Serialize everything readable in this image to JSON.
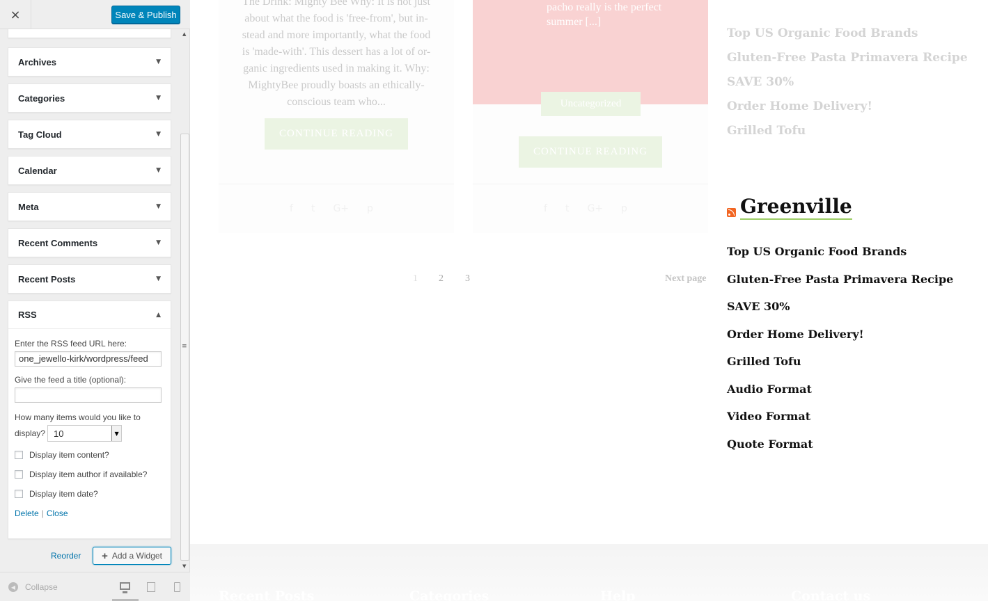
{
  "toolbar": {
    "close_icon": "×",
    "publish_label": "Save & Publish"
  },
  "widgets": [
    {
      "label": "Archives"
    },
    {
      "label": "Categories"
    },
    {
      "label": "Tag Cloud"
    },
    {
      "label": "Calendar"
    },
    {
      "label": "Meta"
    },
    {
      "label": "Recent Comments"
    },
    {
      "label": "Recent Posts"
    }
  ],
  "rss_widget": {
    "label": "RSS",
    "url_label": "Enter the RSS feed URL here:",
    "url_value": "one_jewello-kirk/wordpress/feed",
    "title_label": "Give the feed a title (optional):",
    "title_value": "",
    "items_label_1": "How many items would you like to",
    "items_label_2": "display?",
    "items_value": "10",
    "opt_content": "Display item content?",
    "opt_author": "Display item author if available?",
    "opt_date": "Display item date?",
    "delete": "Delete",
    "separator": "|",
    "close": "Close"
  },
  "panel": {
    "reorder": "Reorder",
    "add_widget": "Add a Widget",
    "collapse": "Collapse"
  },
  "preview": {
    "post1_excerpt": [
      "The Drink: Mighty Bee Why: It is not just",
      "about what the food is 'free-from', but in-",
      "stead and more importantly, what the food",
      "is 'made-with'. This dessert has a lot of or-",
      "ganic ingredients used in making it. Why:",
      "MightyBee proudly boasts an ethically-",
      "conscious team who..."
    ],
    "post2_excerpt": [
      "pacho really is the perfect",
      "summer [...]"
    ],
    "category": "Uncategorized",
    "continue_reading": "CONTINUE READING",
    "share_icons": [
      "f",
      "t",
      "G+",
      "p"
    ],
    "pages": [
      "1",
      "2",
      "3"
    ],
    "next_page": "Next page",
    "recent_list": [
      "Top US Organic Food Brands",
      "Gluten-Free Pasta Primavera Recipe",
      "SAVE 30%",
      "Order Home Delivery!",
      "Grilled Tofu"
    ],
    "rss_title": "Greenville",
    "rss_items": [
      "Top US Organic Food Brands",
      "Gluten-Free Pasta Primavera Recipe",
      "SAVE 30%",
      "Order Home Delivery!",
      "Grilled Tofu",
      "Audio Format",
      "Video Format",
      "Quote Format"
    ],
    "footer_headings": [
      "Recent Posts",
      "Categories",
      "Help",
      "Contact us"
    ]
  }
}
